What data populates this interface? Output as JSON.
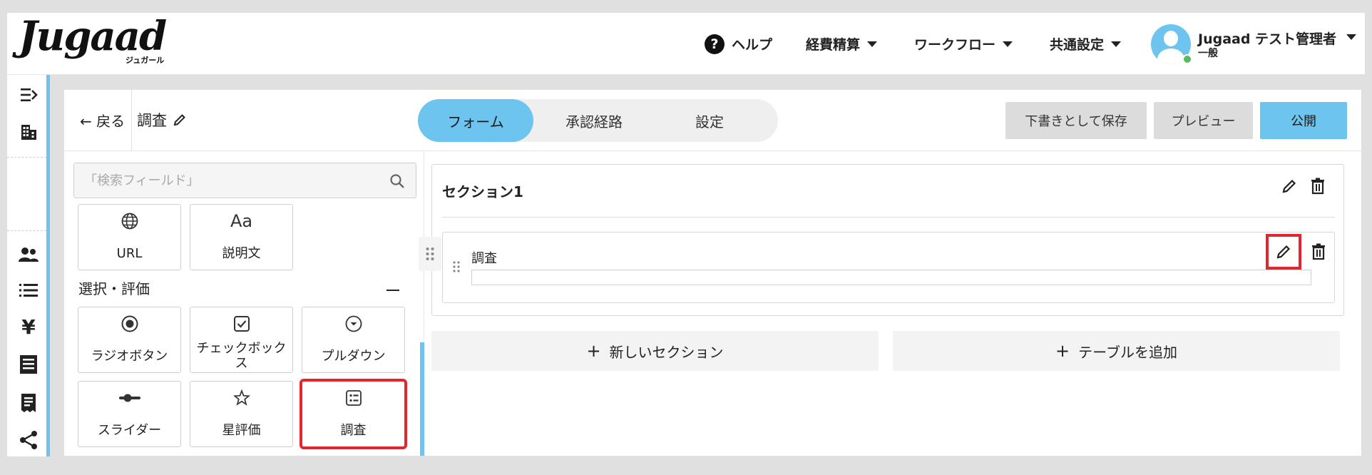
{
  "header": {
    "logo_text": "Jugaad",
    "logo_sub": "ジュガール",
    "nav": {
      "help": "ヘルプ",
      "expense": "経費精算",
      "workflow": "ワークフロー",
      "common": "共通設定"
    },
    "user": {
      "name": "Jugaad テスト管理者",
      "role": "一般"
    }
  },
  "rail": {
    "icons": [
      "collapse-menu-icon",
      "building-icon",
      "users-icon",
      "list-icon",
      "yen-icon",
      "document-icon",
      "receipt-icon",
      "share-icon"
    ]
  },
  "toolbar": {
    "back_label": "← 戻る",
    "form_name": "調査",
    "tabs": [
      "フォーム",
      "承認経路",
      "設定"
    ],
    "active_tab": "フォーム",
    "save_draft": "下書きとして保存",
    "preview": "プレビュー",
    "publish": "公開"
  },
  "palette": {
    "search_placeholder": "「検索フィールド」",
    "top_tiles": [
      {
        "label": "URL",
        "icon": "globe-icon"
      },
      {
        "label": "説明文",
        "icon": "text-aa-icon",
        "icon_text": "Aa"
      }
    ],
    "group_title": "選択・評価",
    "group_tiles": [
      {
        "label": "ラジオボタン",
        "icon": "radio-icon"
      },
      {
        "label": "チェックボックス",
        "icon": "checkbox-icon"
      },
      {
        "label": "プルダウン",
        "icon": "dropdown-icon"
      },
      {
        "label": "スライダー",
        "icon": "slider-icon"
      },
      {
        "label": "星評価",
        "icon": "star-icon"
      },
      {
        "label": "調査",
        "icon": "survey-icon",
        "selected": true
      }
    ]
  },
  "canvas": {
    "section_title": "セクション1",
    "field_label": "調査",
    "field_value": "",
    "add_section": "新しいセクション",
    "add_table": "テーブルを追加"
  },
  "colors": {
    "accent": "#6cc4ef",
    "highlight": "#e3262d",
    "online": "#5cb85c"
  }
}
